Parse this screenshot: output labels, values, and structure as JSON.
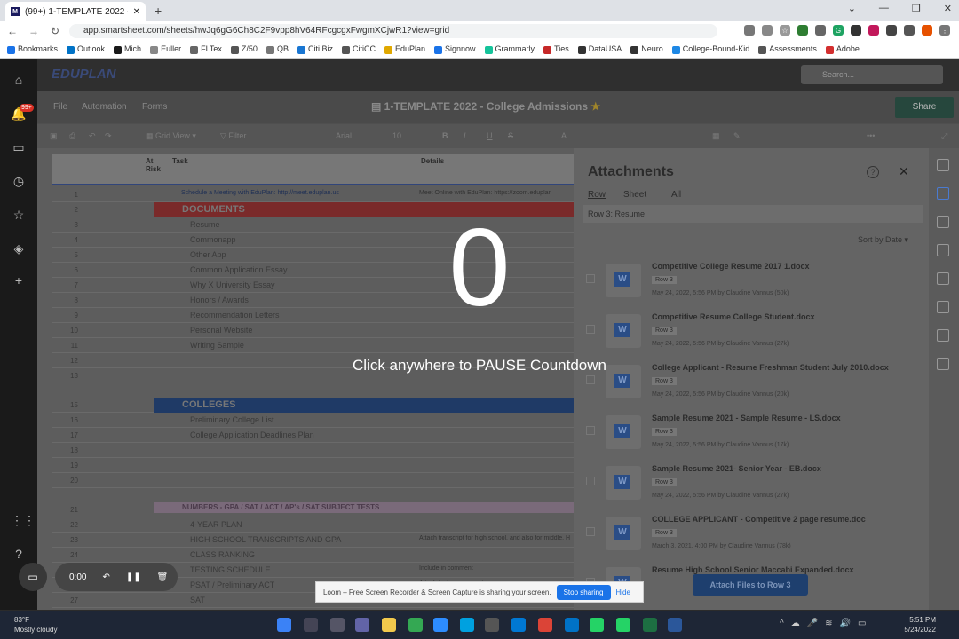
{
  "browser": {
    "tab_title": "(99+) 1-TEMPLATE 2022 - Colleg",
    "url": "app.smartsheet.com/sheets/hwJq6gG6Ch8C2F9vpp8hV64RFcgcgxFwgmXCjwR1?view=grid",
    "bookmarks": [
      "Bookmarks",
      "Outlook",
      "Mich",
      "Euller",
      "FLTex",
      "Z/50",
      "QB",
      "Citi Biz",
      "CitiCC",
      "EduPlan",
      "Signnow",
      "Grammarly",
      "Ties",
      "DataUSA",
      "Neuro",
      "College-Bound-Kid",
      "Assessments",
      "Adobe"
    ]
  },
  "app": {
    "logo": "EDUPLAN",
    "search_placeholder": "Search...",
    "menu": [
      "File",
      "Automation",
      "Forms"
    ],
    "doc_title": "1-TEMPLATE 2022 - College Admissions",
    "share_label": "Share",
    "toolbar": {
      "grid_view": "Grid View",
      "filter": "Filter",
      "font": "Arial",
      "size": "10"
    },
    "notification_count": "99+"
  },
  "grid": {
    "headers": {
      "at_risk": "At Risk",
      "task": "Task",
      "details": "Details"
    },
    "rows": [
      {
        "n": "1",
        "task": "Schedule a Meeting with EduPlan: http://meet.eduplan.us",
        "details": "Meet Online with EduPlan: https://zoom.eduplan"
      },
      {
        "n": "2",
        "section": "DOCUMENTS"
      },
      {
        "n": "3",
        "task": "Resume",
        "details": ""
      },
      {
        "n": "4",
        "task": "Commonapp",
        "details": ""
      },
      {
        "n": "5",
        "task": "Other App",
        "details": ""
      },
      {
        "n": "6",
        "task": "Common Application Essay",
        "details": ""
      },
      {
        "n": "7",
        "task": "Why X University Essay",
        "details": ""
      },
      {
        "n": "8",
        "task": "Honors / Awards",
        "details": ""
      },
      {
        "n": "9",
        "task": "Recommendation Letters",
        "details": ""
      },
      {
        "n": "10",
        "task": "Personal Website",
        "details": ""
      },
      {
        "n": "11",
        "task": "Writing Sample",
        "details": ""
      },
      {
        "n": "12",
        "task": "",
        "details": ""
      },
      {
        "n": "13",
        "task": "",
        "details": ""
      },
      {
        "n": "15",
        "section": "COLLEGES"
      },
      {
        "n": "16",
        "task": "Preliminary College List",
        "details": ""
      },
      {
        "n": "17",
        "task": "College Application Deadlines Plan",
        "details": ""
      },
      {
        "n": "18",
        "task": "",
        "details": ""
      },
      {
        "n": "19",
        "task": "",
        "details": ""
      },
      {
        "n": "20",
        "task": "",
        "details": ""
      },
      {
        "n": "21",
        "section": "NUMBERS - GPA / SAT / ACT / AP's / SAT SUBJECT TESTS"
      },
      {
        "n": "22",
        "task": "4-YEAR PLAN",
        "details": ""
      },
      {
        "n": "23",
        "task": "HIGH SCHOOL TRANSCRIPTS AND GPA",
        "details": "Attach transcript for high school, and also for middle. High school website weave-web and during middle.scho"
      },
      {
        "n": "24",
        "task": "CLASS RANKING",
        "details": ""
      },
      {
        "n": "25",
        "task": "TESTING SCHEDULE",
        "details": "Include in comment"
      },
      {
        "n": "26",
        "task": "PSAT / Preliminary ACT",
        "details": "Attach test score report"
      },
      {
        "n": "27",
        "task": "SAT",
        "details": ""
      },
      {
        "n": "28",
        "task": "ACT",
        "details": ""
      }
    ]
  },
  "attachments": {
    "title": "Attachments",
    "tabs": [
      "Row",
      "Sheet",
      "All"
    ],
    "row_context": "Row 3: Resume",
    "sort_label": "Sort by Date",
    "files": [
      {
        "name": "Competitive College Resume 2017 1.docx",
        "row": "Row 3",
        "meta": "May 24, 2022, 5:56 PM by Claudine Vannus (50k)"
      },
      {
        "name": "Competitive Resume College Student.docx",
        "row": "Row 3",
        "meta": "May 24, 2022, 5:56 PM by Claudine Vannus (27k)"
      },
      {
        "name": "College Applicant - Resume Freshman Student July 2010.docx",
        "row": "Row 3",
        "meta": "May 24, 2022, 5:56 PM by Claudine Vannus (20k)"
      },
      {
        "name": "Sample Resume 2021 - Sample Resume - LS.docx",
        "row": "Row 3",
        "meta": "May 24, 2022, 5:56 PM by Claudine Vannus (17k)"
      },
      {
        "name": "Sample Resume 2021- Senior Year - EB.docx",
        "row": "Row 3",
        "meta": "May 24, 2022, 5:56 PM by Claudine Vannus (27k)"
      },
      {
        "name": "COLLEGE APPLICANT - Competitive 2 page resume.doc",
        "row": "Row 3",
        "meta": "March 3, 2021, 4:00 PM by Claudine Vannus (78k)"
      },
      {
        "name": "Resume High School Senior Maccabi Expanded.docx",
        "row": "",
        "meta": ""
      }
    ],
    "attach_button": "Attach Files to Row 3"
  },
  "overlay": {
    "countdown": "0",
    "message": "Click anywhere to PAUSE Countdown",
    "timer": "0:00"
  },
  "loom": {
    "text": "Loom – Free Screen Recorder & Screen Capture is sharing your screen.",
    "stop": "Stop sharing",
    "hide": "Hide"
  },
  "taskbar": {
    "temp": "83°F",
    "weather": "Mostly cloudy",
    "time": "5:51 PM",
    "date": "5/24/2022"
  }
}
